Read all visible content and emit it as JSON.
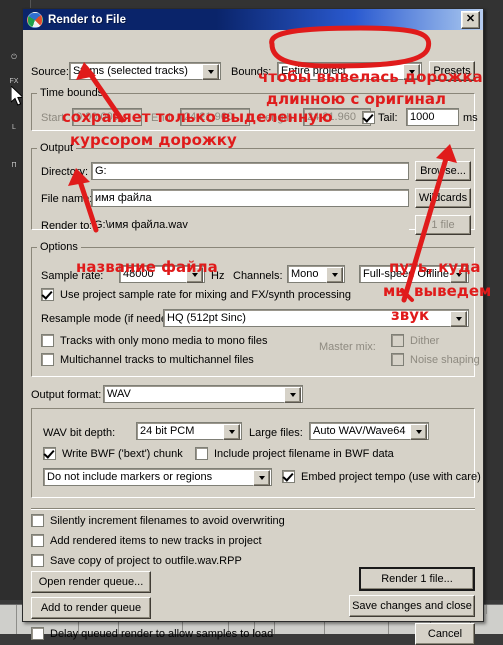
{
  "window": {
    "title": "Render to File",
    "close_label": "✕",
    "app_icon": "reaper-logo-icon"
  },
  "top": {
    "source_label": "Source:",
    "source_value": "Stems (selected tracks)",
    "bounds_label": "Bounds:",
    "bounds_value": "Entire project",
    "presets_label": "Presets"
  },
  "time_bounds": {
    "group_label": "Time bounds",
    "start_label": "Start:",
    "start_value": "0:00.000",
    "end_label": "End:",
    "end_value": "24:21.960",
    "length_label": "Length:",
    "length_value": "24:21.960",
    "tail_checked": true,
    "tail_label": "Tail:",
    "tail_value": "1000",
    "tail_units": "ms"
  },
  "output": {
    "group_label": "Output",
    "directory_label": "Directory:",
    "directory_value": "G:",
    "browse_label": "Browse...",
    "filename_label": "File name:",
    "filename_value": "имя файла",
    "wildcards_label": "Wildcards",
    "renderto_label": "Render to:",
    "renderto_value": "G:\\имя файла.wav",
    "filecount_label": "1 file"
  },
  "options": {
    "group_label": "Options",
    "sample_rate_label": "Sample rate:",
    "sample_rate_value": "48000",
    "hz_label": "Hz",
    "channels_label": "Channels:",
    "channels_value": "Mono",
    "speed_value": "Full-speed Offline",
    "use_project_sr_checked": true,
    "use_project_sr_label": "Use project sample rate for mixing and FX/synth processing",
    "resample_label": "Resample mode (if needed):",
    "resample_value": "HQ (512pt Sinc)",
    "mono_tracks_checked": false,
    "mono_tracks_label": "Tracks with only mono media to mono files",
    "multichannel_checked": false,
    "multichannel_label": "Multichannel tracks to multichannel files",
    "master_mix_label": "Master mix:",
    "dither_checked": false,
    "dither_label": "Dither",
    "noise_shaping_checked": false,
    "noise_shaping_label": "Noise shaping"
  },
  "format": {
    "output_format_label": "Output format:",
    "output_format_value": "WAV",
    "bit_depth_label": "WAV bit depth:",
    "bit_depth_value": "24 bit PCM",
    "large_files_label": "Large files:",
    "large_files_value": "Auto WAV/Wave64",
    "bwf_checked": true,
    "bwf_label": "Write BWF ('bext') chunk",
    "include_project_filename_checked": false,
    "include_project_filename_label": "Include project filename in BWF data",
    "markers_value": "Do not include markers or regions",
    "embed_tempo_checked": true,
    "embed_tempo_label": "Embed project tempo (use with care)"
  },
  "bottom_checks": {
    "silently_increment_checked": false,
    "silently_increment_label": "Silently increment filenames to avoid overwriting",
    "add_rendered_checked": false,
    "add_rendered_label": "Add rendered items to new tracks in project",
    "save_copy_checked": false,
    "save_copy_label": "Save copy of project to outfile.wav.RPP",
    "delay_queued_checked": false,
    "delay_queued_label": "Delay queued render to allow samples to load"
  },
  "buttons": {
    "open_render_queue": "Open render queue...",
    "add_to_render_queue": "Add to render queue",
    "render_1_file": "Render 1 file...",
    "save_changes_and_close": "Save changes and close",
    "cancel": "Cancel"
  },
  "annotations": {
    "color": "#e01b1b",
    "items": [
      {
        "text": "чтобы вывелась дорожка"
      },
      {
        "text": "длинною с оригинал"
      },
      {
        "text": "сохраняет только выделенную"
      },
      {
        "text": "курсором дорожку"
      },
      {
        "text": "название файла"
      },
      {
        "text": "путь, куда"
      },
      {
        "text": "мы выведем"
      },
      {
        "text": "звук"
      }
    ]
  },
  "background_app": {
    "track_buttons": [
      "⏻",
      "FX",
      "L",
      "П"
    ]
  }
}
